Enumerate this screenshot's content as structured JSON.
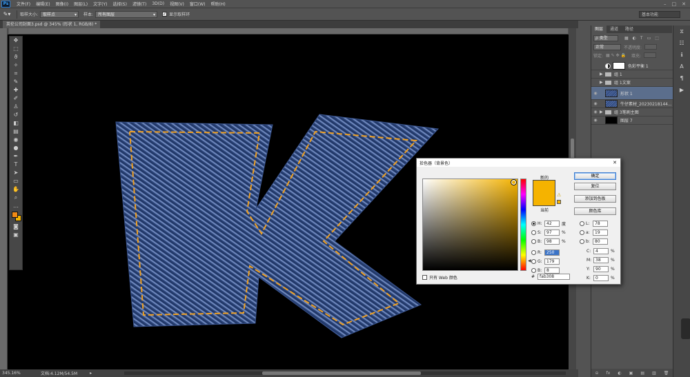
{
  "app": {
    "logo": "Ps",
    "menu": [
      "文件(F)",
      "编辑(E)",
      "图像(I)",
      "图层(L)",
      "文字(Y)",
      "选择(S)",
      "滤镜(T)",
      "3D(D)",
      "视图(V)",
      "窗口(W)",
      "帮助(H)"
    ],
    "window_controls": [
      "–",
      "□",
      "✕"
    ]
  },
  "options_bar": {
    "sample_size_label": "取样大小:",
    "sample_size_value": "取样点",
    "sample_label": "样本:",
    "sample_value": "所有图层",
    "show_ring_label": "显示取样环",
    "show_ring_checked": true,
    "workspace": "基本功能"
  },
  "document": {
    "tab_title": "英伦公司封面3.psd @ 345% (形状 1, RGB/8) *",
    "zoom": "345.16%",
    "doc_info": "文档:4.12M/54.5M"
  },
  "canvas": {
    "artwork": "denim-letter-K",
    "stitch_color": "#f0a020",
    "denim_dark": "#1e3465",
    "denim_light": "#6f88bd"
  },
  "colors": {
    "foreground": "#f08a16",
    "background": "#f5b300"
  },
  "layers_panel": {
    "tabs": [
      "图层",
      "通道",
      "路径"
    ],
    "kind_label": "ρ 类型",
    "blend_mode": "正常",
    "opacity_label": "不透明度:",
    "lock_label": "锁定:",
    "fill_label": "填充:",
    "layers": [
      {
        "name": "色彩平衡 1",
        "type": "adjustment",
        "visible": false,
        "selected": false
      },
      {
        "name": "组 1",
        "type": "group",
        "visible": false,
        "selected": false
      },
      {
        "name": "组 1文案",
        "type": "group",
        "visible": false,
        "selected": false
      },
      {
        "name": "形状 1",
        "type": "shape",
        "visible": true,
        "selected": true
      },
      {
        "name": "牛仔素材_20230218144...",
        "type": "image",
        "visible": true,
        "selected": false
      },
      {
        "name": "组 3笔刷主图",
        "type": "group",
        "visible": true,
        "selected": false
      },
      {
        "name": "图层 7",
        "type": "pixel",
        "visible": true,
        "selected": false
      }
    ],
    "bottom_icons": [
      "⊝",
      "fx",
      "◐",
      "▣",
      "▤",
      "▥",
      "🗑"
    ]
  },
  "color_picker": {
    "title": "拾色器（背景色）",
    "new_label": "新的",
    "current_label": "当前",
    "new_color": "#f5b300",
    "buttons": {
      "ok": "确定",
      "reset": "复位",
      "add_swatch": "添加到色板",
      "libraries": "颜色库"
    },
    "hsb": [
      {
        "key": "H:",
        "value": "42",
        "unit": "度",
        "selected": true
      },
      {
        "key": "S:",
        "value": "97",
        "unit": "%",
        "selected": false
      },
      {
        "key": "B:",
        "value": "98",
        "unit": "%",
        "selected": false
      }
    ],
    "rgb": [
      {
        "key": "R:",
        "value": "250",
        "highlighted": true
      },
      {
        "key": "G:",
        "value": "179",
        "highlighted": false
      },
      {
        "key": "B:",
        "value": "8",
        "highlighted": false
      }
    ],
    "lab": [
      {
        "key": "L:",
        "value": "78"
      },
      {
        "key": "a:",
        "value": "19"
      },
      {
        "key": "b:",
        "value": "80"
      }
    ],
    "cmyk": [
      {
        "key": "C:",
        "value": "4",
        "unit": "%"
      },
      {
        "key": "M:",
        "value": "38",
        "unit": "%"
      },
      {
        "key": "Y:",
        "value": "90",
        "unit": "%"
      },
      {
        "key": "K:",
        "value": "0",
        "unit": "%"
      }
    ],
    "hex_label": "#",
    "hex": "fab308",
    "web_only_label": "只有 Web 颜色"
  }
}
